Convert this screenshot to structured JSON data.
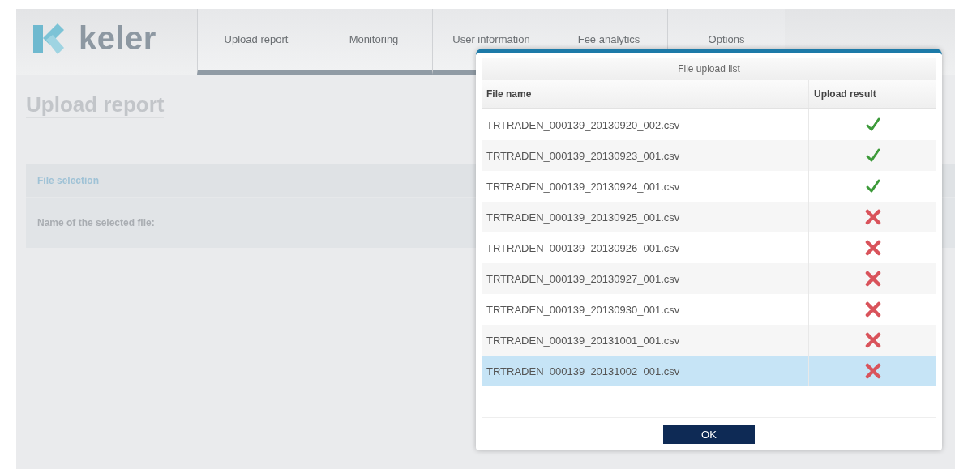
{
  "logo": {
    "text": "keler"
  },
  "tabs": [
    {
      "label": "Upload report"
    },
    {
      "label": "Monitoring"
    },
    {
      "label": "User information"
    },
    {
      "label": "Fee analytics"
    },
    {
      "label": "Options"
    }
  ],
  "page": {
    "title": "Upload report",
    "section": "File selection",
    "field_label": "Name of the selected file:"
  },
  "dialog": {
    "title": "File upload list",
    "columns": [
      "File name",
      "Upload result"
    ],
    "rows": [
      {
        "file": "TRTRADEN_000139_20130920_002.csv",
        "uploaded": true,
        "selected": false
      },
      {
        "file": "TRTRADEN_000139_20130923_001.csv",
        "uploaded": true,
        "selected": false
      },
      {
        "file": "TRTRADEN_000139_20130924_001.csv",
        "uploaded": true,
        "selected": false
      },
      {
        "file": "TRTRADEN_000139_20130925_001.csv",
        "uploaded": false,
        "selected": false
      },
      {
        "file": "TRTRADEN_000139_20130926_001.csv",
        "uploaded": false,
        "selected": false
      },
      {
        "file": "TRTRADEN_000139_20130927_001.csv",
        "uploaded": false,
        "selected": false
      },
      {
        "file": "TRTRADEN_000139_20130930_001.csv",
        "uploaded": false,
        "selected": false
      },
      {
        "file": "TRTRADEN_000139_20131001_001.csv",
        "uploaded": false,
        "selected": false
      },
      {
        "file": "TRTRADEN_000139_20131002_001.csv",
        "uploaded": false,
        "selected": true
      }
    ],
    "ok_button": "OK"
  }
}
